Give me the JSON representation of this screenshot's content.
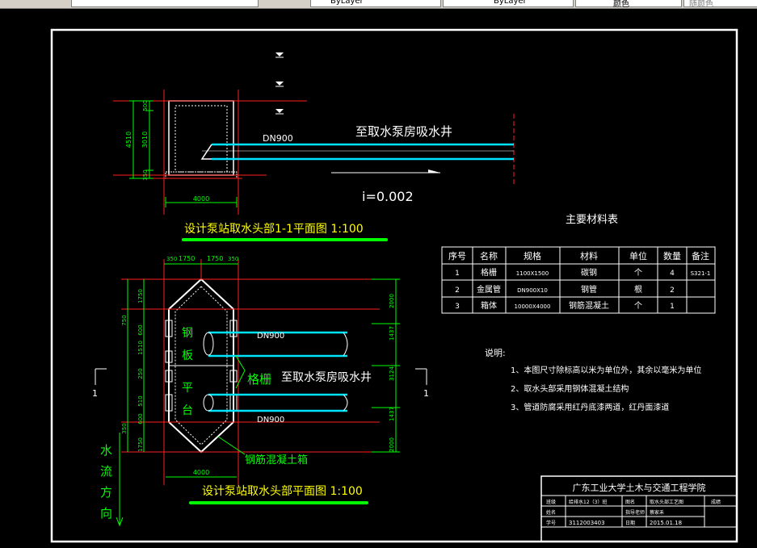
{
  "toolbar": {
    "layer_dropdown": "ByLayer",
    "linetype_dropdown": "ByLayer",
    "color_dropdown": "颜色",
    "style_dropdown": "随颜色"
  },
  "drawing": {
    "section_title": "设计泵站取水头部1-1平面图 1:100",
    "plan_title": "设计泵站取水头部平面图 1:100",
    "pipe_label_top": "DN900",
    "pipe_dest_top": "至取水泵房吸水井",
    "slope_label": "i=0.002",
    "pipe_label_upper": "DN900",
    "pipe_label_lower": "DN900",
    "pipe_dest_plan": "至取水泵房吸水井",
    "grating_label": "格栅",
    "steel_plate_chars": [
      "钢",
      "板",
      "平",
      "台"
    ],
    "box_label": "钢筋混凝土箱",
    "flow_chars": [
      "水",
      "流",
      "方",
      "向"
    ],
    "section_marker_left": "1",
    "section_marker_right": "1",
    "dims_section": {
      "total_height": "4510",
      "inner_height": "3010",
      "top_part": "500",
      "bottom_part": "350",
      "width": "4000"
    },
    "dims_plan": {
      "top": [
        "350",
        "1750",
        "1750",
        "350"
      ],
      "left": [
        "1750",
        "750",
        "600",
        "1510",
        "250",
        "510",
        "600",
        "350",
        "1750"
      ],
      "right": [
        "2000",
        "1437",
        "3124",
        "1437",
        "2000"
      ],
      "bottom_width": "4000"
    }
  },
  "material_table": {
    "title": "主要材料表",
    "headers": [
      "序号",
      "名称",
      "规格",
      "材料",
      "单位",
      "数量",
      "备注"
    ],
    "rows": [
      [
        "1",
        "格栅",
        "1100X1500",
        "碳钢",
        "个",
        "4",
        "S321-1"
      ],
      [
        "2",
        "金属管",
        "DN900X10",
        "钢管",
        "根",
        "2",
        ""
      ],
      [
        "3",
        "箱体",
        "10000X4000",
        "钢筋混凝土",
        "个",
        "1",
        ""
      ]
    ]
  },
  "notes": {
    "title": "说明:",
    "items": [
      "1、本图尺寸除标高以米为单位外，其余以毫米为单位",
      "2、取水头部采用钢体混凝土结构",
      "3、管道防腐采用红丹底漆两道，红丹面漆道"
    ]
  },
  "title_block": {
    "institution": "广东工业大学土木与交通工程学院",
    "r1": [
      "班级",
      "给排水12（3）班",
      "图名",
      "取水头部工艺图",
      "成绩"
    ],
    "r2": [
      "姓名",
      "",
      "指导老师",
      "蔡家禾"
    ],
    "r3": [
      "学号",
      "3112003403",
      "日期",
      "2015.01.18"
    ]
  },
  "colors": {
    "frame": "#ffffff",
    "dimension": "#00ff00",
    "pipe": "#00e5ff",
    "wall": "#ffffff",
    "red_line": "#ff2020",
    "title_green": "#00ff00",
    "text_yellow": "#ffff00"
  }
}
